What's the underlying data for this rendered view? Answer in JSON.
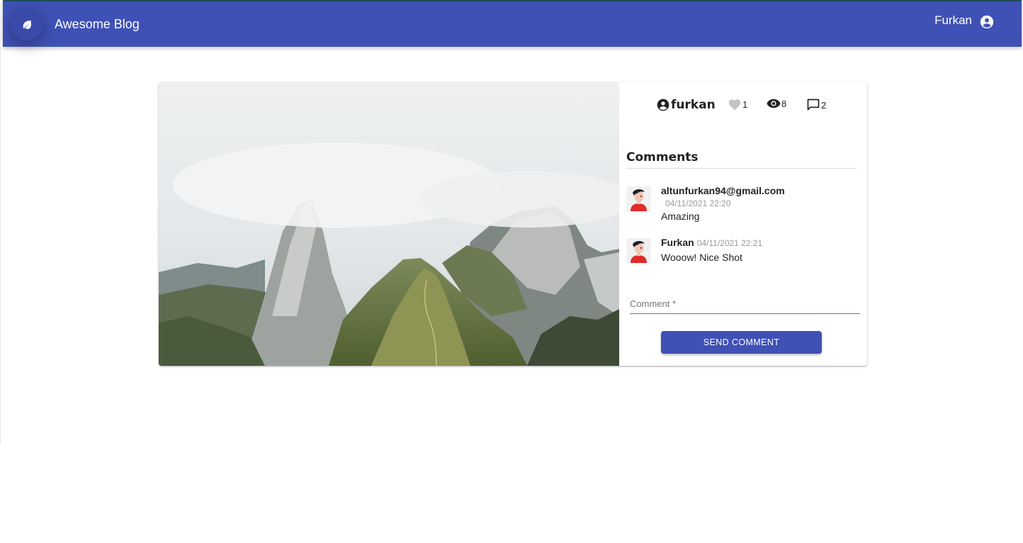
{
  "appbar": {
    "title": "Awesome Blog",
    "user_name": "Furkan",
    "logo_icon": "leaf-icon",
    "account_icon": "account-circle-icon",
    "color": "#3f51b5"
  },
  "post": {
    "image_icon": "mountain-landscape-photo",
    "author": "furkan",
    "likes": "1",
    "views": "8",
    "comment_count": "2"
  },
  "comments": {
    "title": "Comments",
    "items": [
      {
        "author": "altunfurkan94@gmail.com",
        "date": "04/11/2021 22:20",
        "text": "Amazing"
      },
      {
        "author": "Furkan",
        "date": "04/11/2021 22:21",
        "text": "Wooow! Nice Shot"
      }
    ]
  },
  "form": {
    "comment_label": "Comment",
    "required_mark": " *",
    "comment_value": "",
    "send_label": "SEND COMMENT"
  }
}
